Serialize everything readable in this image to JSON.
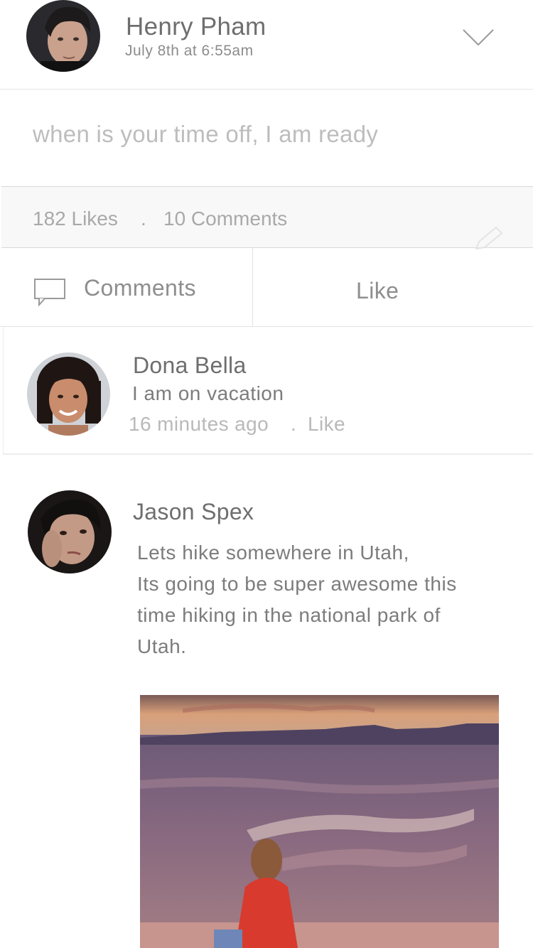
{
  "post": {
    "author": "Henry Pham",
    "time": "July 8th at 6:55am",
    "text": "when is your time off, I am ready",
    "likes": "182 Likes",
    "separator": ".",
    "comments": "10 Comments"
  },
  "actions": {
    "comments_label": "Comments",
    "like_label": "Like"
  },
  "comments": [
    {
      "name": "Dona Bella",
      "text": "I am on vacation",
      "time": "16 minutes ago",
      "separator": ".",
      "like_label": "Like"
    },
    {
      "name": "Jason Spex",
      "lines": [
        "Lets hike somewhere in Utah,",
        "Its going to be super awesome this",
        "time hiking in the national park of",
        "Utah."
      ]
    }
  ],
  "icons": {
    "dropdown": "chevron-down-icon",
    "comment": "comment-bubble-icon",
    "edit": "pencil-icon"
  },
  "colors": {
    "text_primary": "#6e6e6e",
    "text_muted": "#b9b9b9",
    "stats_background": "#f8f8f8",
    "divider": "#e2e2e2"
  }
}
